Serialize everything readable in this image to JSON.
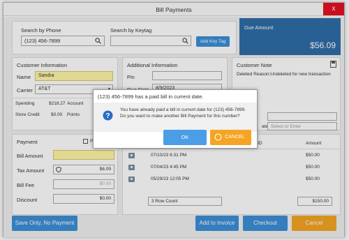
{
  "window": {
    "title": "Bill Payments",
    "close_glyph": "x"
  },
  "search": {
    "phone_label": "Search by Phone",
    "phone_value": "(123) 456-7899",
    "keytag_label": "Search by Keytag",
    "keytag_value": "",
    "add_key_tag": "Add Key Tag"
  },
  "due": {
    "label": "Due Amount",
    "amount": "$56.09"
  },
  "customer": {
    "header": "Customer Information",
    "name_label": "Name",
    "name_value": "Sandra",
    "carrier_label": "Carrier",
    "carrier_value": "AT&T",
    "spending_label": "Spending",
    "spending_value": "$218.27",
    "account_label": "Account",
    "store_credit_label": "Store Credit",
    "store_credit_value": "$0.00",
    "points_label": "Points"
  },
  "additional": {
    "header": "Additional Information",
    "pin_label": "Pin",
    "pin_value": "",
    "due_date_label": "Due Date",
    "due_date_value": "8/9/2023"
  },
  "note": {
    "header": "Customer Note",
    "text": "Deleted Reason:Undeleted for new transaction",
    "ate_label": "ate",
    "select_placeholder": "Select or Enter"
  },
  "payment": {
    "header": "Payment",
    "print_label": "Pri",
    "bill_amount_label": "Bill Amount",
    "bill_amount_value": "",
    "tax_amount_label": "Tax Amount",
    "tax_amount_value": "$6.09",
    "bill_fee_label": "Bill Fee",
    "bill_fee_value": "$0.00",
    "discount_label": "Discount",
    "discount_value": "$0.00"
  },
  "history": {
    "col_id": "nt ID",
    "col_amount": "Amount",
    "rows": [
      {
        "date": "07/10/23 6:31 PM",
        "amount": "$50.00"
      },
      {
        "date": "07/04/23 4:45 PM",
        "amount": "$50.00"
      },
      {
        "date": "05/29/23 12:05 PM",
        "amount": "$50.00"
      }
    ],
    "row_count": "3 Row Count",
    "total": "$150.00"
  },
  "footer": {
    "save_only": "Save Only, No Payment",
    "add_invoice": "Add to Invoice",
    "checkout": "Checkout",
    "cancel": "Cancel"
  },
  "dialog": {
    "title": "(123) 456-7899 has a paid bill in current date.",
    "message": "You have already paid a bill in current date for (123) 456-7899. Do you want to make another Bill Payment for this number?",
    "ok": "OK",
    "cancel": "CANCEL"
  },
  "colors": {
    "accent": "#3d8fd8",
    "due_bg": "#2f6ea8",
    "cancel": "#f5a524",
    "close": "#e81123",
    "highlight": "#fff6a8"
  }
}
